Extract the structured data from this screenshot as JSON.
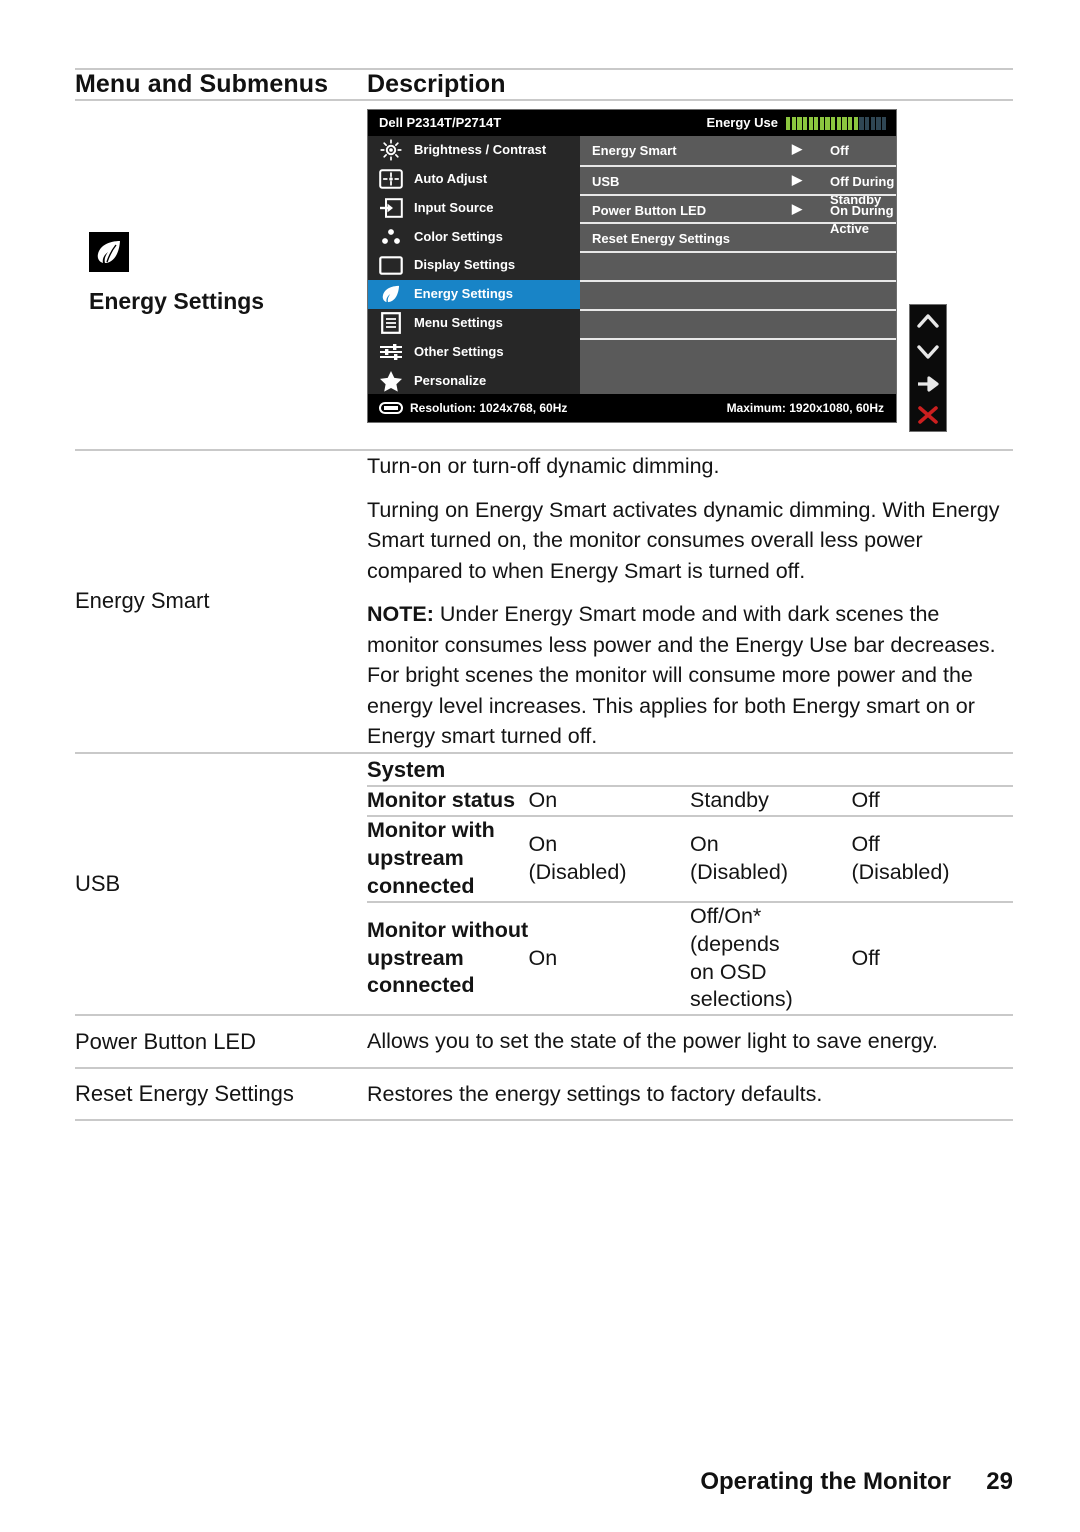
{
  "header": {
    "col_menu": "Menu and Submenus",
    "col_description": "Description"
  },
  "rows": {
    "energy_settings": {
      "label": "Energy Settings",
      "icon": "leaf-icon"
    },
    "energy_smart": {
      "label": "Energy Smart",
      "p1": "Turn-on or turn-off dynamic dimming.",
      "p2": "Turning on Energy Smart activates dynamic dimming. With Energy Smart turned on, the monitor consumes overall less power compared to when Energy Smart is turned off.",
      "note_label": "NOTE:",
      "note_text": " Under Energy Smart mode and with dark scenes the monitor consumes less power and the Energy Use bar decreases. For bright scenes the monitor will consume more power and the energy level increases. This applies for both Energy smart on or Energy smart turned off."
    },
    "usb": {
      "label": "USB"
    },
    "power_button_led": {
      "label": "Power Button LED",
      "description": "Allows you to set the state of the power light to save energy."
    },
    "reset_energy_settings": {
      "label": "Reset Energy Settings",
      "description": "Restores the energy settings to factory defaults."
    }
  },
  "usb_table": {
    "title": "System",
    "rows": [
      {
        "label": "Monitor status",
        "label_lines": [
          "Monitor status"
        ],
        "values": [
          "On",
          "Standby",
          "Off"
        ]
      },
      {
        "label": "Monitor with upstream connected",
        "label_lines": [
          "Monitor with",
          "upstream",
          "connected"
        ],
        "values": [
          "On\n(Disabled)",
          "On\n(Disabled)",
          "Off\n(Disabled)"
        ]
      },
      {
        "label": "Monitor without upstream connected",
        "label_lines": [
          "Monitor without",
          "upstream",
          "connected"
        ],
        "values": [
          "On",
          "Off/On*\n(depends\non OSD\nselections)",
          "Off"
        ]
      }
    ]
  },
  "osd": {
    "model": "Dell P2314T/P2714T",
    "energy_use_label": "Energy Use",
    "energy_bar": {
      "total_segments": 18,
      "lit_segments": 13,
      "lit_color": "#8cc63f",
      "unlit_color": "#2f4654"
    },
    "menu_items": [
      {
        "label": "Brightness / Contrast",
        "icon": "brightness-icon",
        "selected": false
      },
      {
        "label": "Auto Adjust",
        "icon": "auto-adjust-icon",
        "selected": false
      },
      {
        "label": "Input Source",
        "icon": "input-source-icon",
        "selected": false
      },
      {
        "label": "Color Settings",
        "icon": "color-settings-icon",
        "selected": false
      },
      {
        "label": "Display Settings",
        "icon": "display-settings-icon",
        "selected": false
      },
      {
        "label": "Energy Settings",
        "icon": "leaf-icon",
        "selected": true
      },
      {
        "label": "Menu Settings",
        "icon": "menu-settings-icon",
        "selected": false
      },
      {
        "label": "Other Settings",
        "icon": "other-settings-icon",
        "selected": false
      },
      {
        "label": "Personalize",
        "icon": "star-icon",
        "selected": false
      }
    ],
    "submenu_items": [
      {
        "label": "Energy Smart",
        "value": "Off",
        "arrow": "▶"
      },
      {
        "label": "USB",
        "value": "Off During Standby",
        "arrow": "▶"
      },
      {
        "label": "Power Button LED",
        "value": "On During Active",
        "arrow": "▶"
      },
      {
        "label": "Reset Energy Settings",
        "value": "",
        "arrow": ""
      },
      {
        "label": "",
        "value": "",
        "arrow": ""
      },
      {
        "label": "",
        "value": "",
        "arrow": ""
      },
      {
        "label": "",
        "value": "",
        "arrow": ""
      },
      {
        "label": "",
        "value": "",
        "arrow": ""
      }
    ],
    "status_resolution": "Resolution:  1024x768, 60Hz",
    "status_maximum": "Maximum: 1920x1080, 60Hz",
    "side_buttons": [
      {
        "name": "up-chevron-icon"
      },
      {
        "name": "down-chevron-icon"
      },
      {
        "name": "right-arrow-icon"
      },
      {
        "name": "close-x-icon"
      }
    ],
    "accent_color": "#1884c7",
    "close_color": "#cc1f1f"
  },
  "footer": {
    "section": "Operating the Monitor",
    "page": "29"
  }
}
